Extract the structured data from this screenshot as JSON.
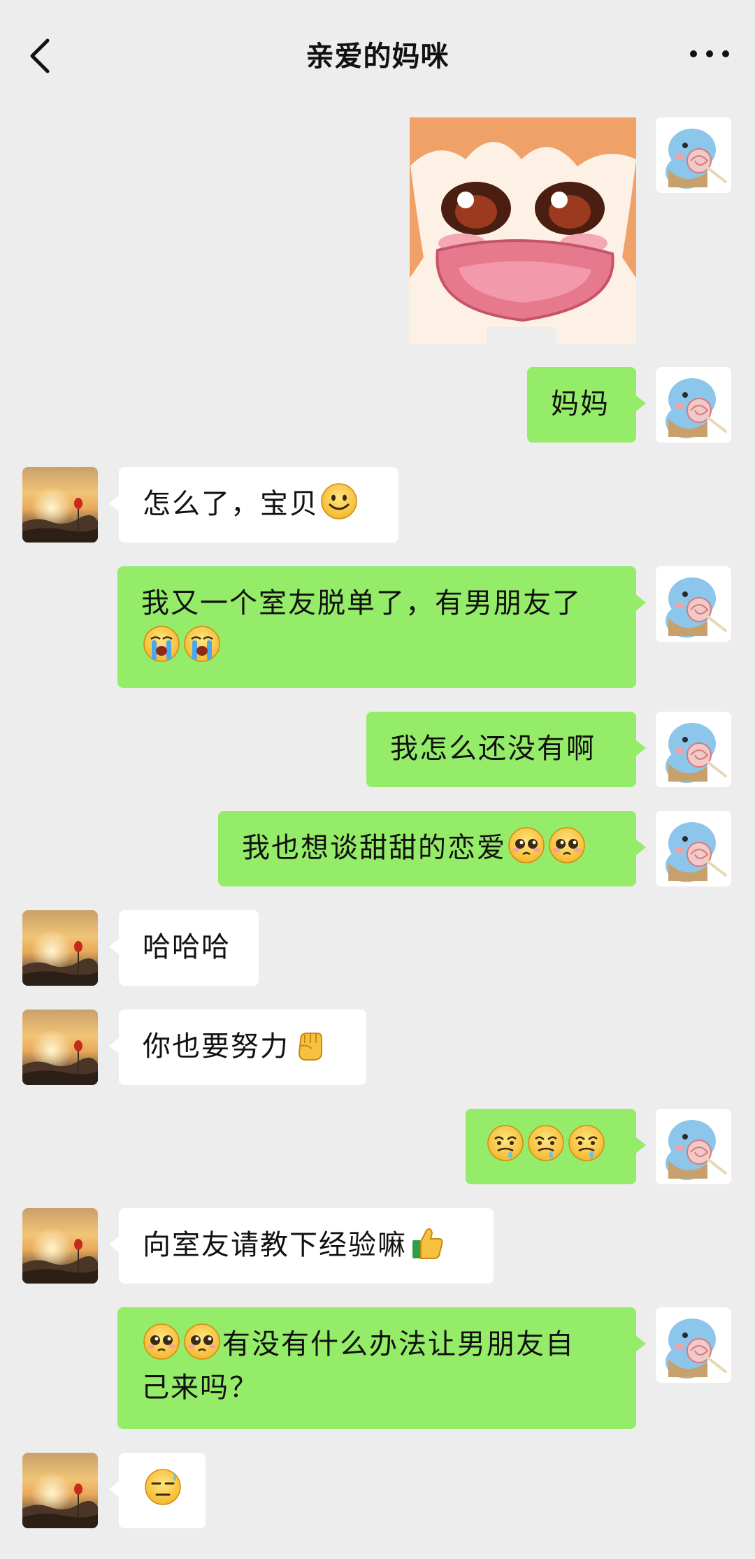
{
  "header": {
    "title": "亲爱的妈咪"
  },
  "messages": [
    {
      "sender": "me",
      "type": "sticker",
      "sticker": "crying-anime-girl"
    },
    {
      "sender": "me",
      "text": "妈妈"
    },
    {
      "sender": "mom",
      "text": "怎么了，宝贝",
      "emoji_after": [
        "smile"
      ]
    },
    {
      "sender": "me",
      "line1": "我又一个室友脱单了，有男朋友了",
      "emoji_line2": [
        "loudly-crying",
        "loudly-crying"
      ]
    },
    {
      "sender": "me",
      "text": "我怎么还没有啊"
    },
    {
      "sender": "me",
      "text": "我也想谈甜甜的恋爱",
      "emoji_after": [
        "pleading",
        "pleading"
      ]
    },
    {
      "sender": "mom",
      "text": "哈哈哈"
    },
    {
      "sender": "mom",
      "text": "你也要努力",
      "emoji_after": [
        "fist"
      ]
    },
    {
      "sender": "me",
      "emoji_only": [
        "drooling",
        "drooling",
        "drooling"
      ]
    },
    {
      "sender": "mom",
      "text": "向室友请教下经验嘛",
      "emoji_after": [
        "thumbs-up"
      ]
    },
    {
      "sender": "me",
      "emoji_before": [
        "pleading",
        "pleading"
      ],
      "line1": "有没有什么办法让男朋友自",
      "line2": "己来吗？"
    },
    {
      "sender": "mom",
      "emoji_only": [
        "sweat-smile"
      ]
    }
  ],
  "colors": {
    "background": "#ededed",
    "my_bubble": "#95ec69",
    "mom_bubble": "#ffffff"
  }
}
